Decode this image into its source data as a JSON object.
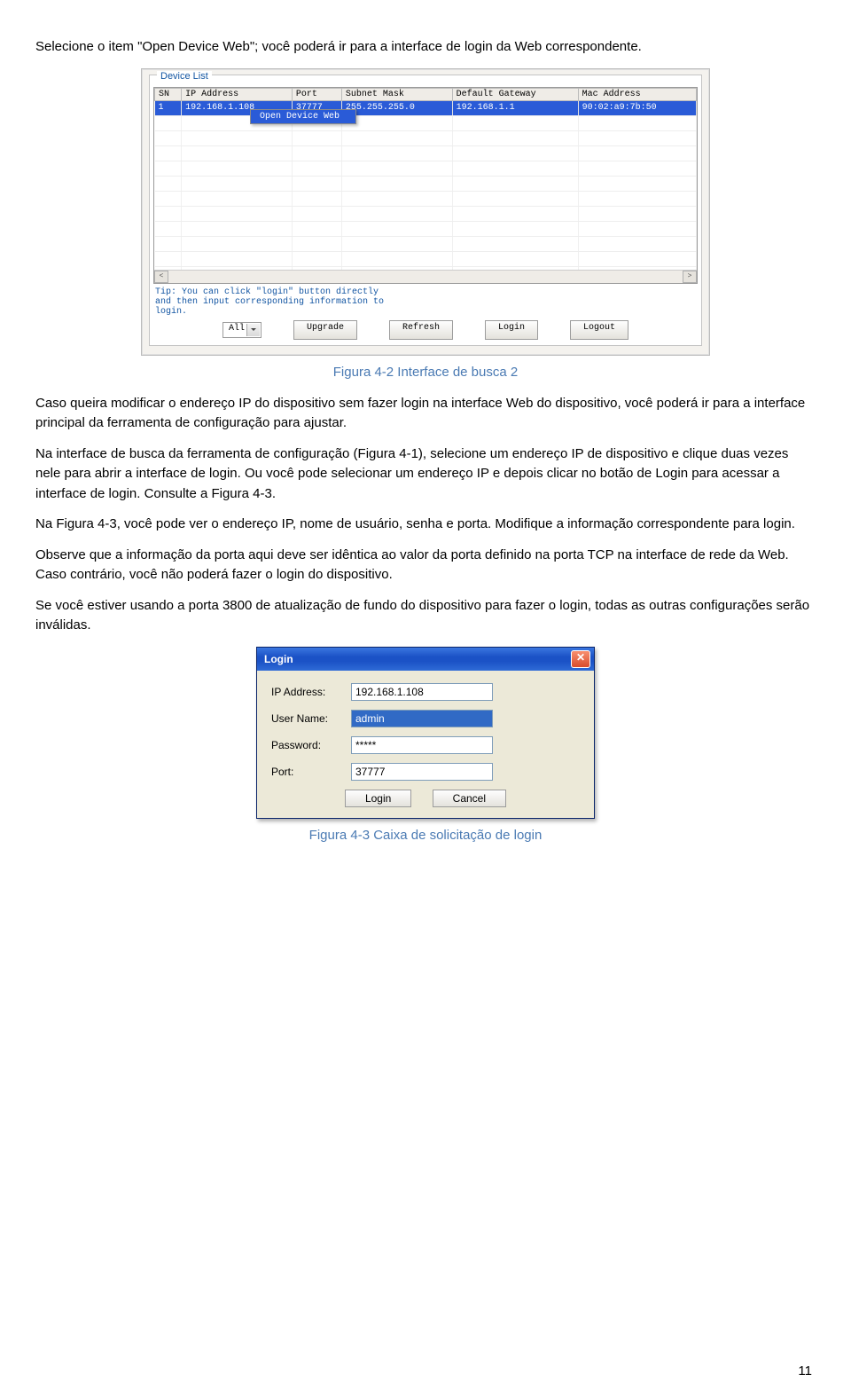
{
  "intro": "Selecione o item \"Open Device Web\"; você poderá ir para a interface de login da Web correspondente.",
  "deviceList": {
    "frameLabel": "Device List",
    "headers": [
      "SN",
      "IP Address",
      "Port",
      "Subnet Mask",
      "Default Gateway",
      "Mac Address"
    ],
    "row": {
      "sn": "1",
      "ip": "192.168.1.108",
      "port": "37777",
      "mask": "255.255.255.0",
      "gateway": "192.168.1.1",
      "mac": "90:02:a9:7b:50"
    },
    "contextMenu": "Open Device Web",
    "tip": "Tip: You can click \"login\" button directly and then input corresponding information to login.",
    "combo": "All",
    "buttons": {
      "upgrade": "Upgrade",
      "refresh": "Refresh",
      "login": "Login",
      "logout": "Logout"
    }
  },
  "caption1": "Figura 4-2 Interface de busca 2",
  "para1": "Caso queira modificar o endereço IP do dispositivo sem fazer login na interface Web do dispositivo, você poderá ir para a interface principal da ferramenta de configuração para ajustar.",
  "para2": "Na interface de busca da ferramenta de configuração (Figura 4-1), selecione um endereço IP de dispositivo e clique duas vezes nele para abrir a interface de login. Ou você pode selecionar um endereço IP e depois clicar no botão de Login para acessar a interface de login. Consulte a Figura 4-3.",
  "para3": "Na Figura 4-3, você pode ver o endereço IP, nome de usuário, senha e porta. Modifique a informação correspondente para login.",
  "para4": "Observe que a informação da porta aqui deve ser idêntica ao valor da porta definido na porta TCP na interface de rede da Web. Caso contrário, você não poderá fazer o login do dispositivo.",
  "para5": "Se você estiver usando a porta 3800 de atualização de fundo do dispositivo para fazer o login, todas as outras configurações serão inválidas.",
  "login": {
    "title": "Login",
    "ipLabel": "IP Address:",
    "ipValue": "192.168.1.108",
    "userLabel": "User Name:",
    "userValue": "admin",
    "pwdLabel": "Password:",
    "pwdValue": "*****",
    "portLabel": "Port:",
    "portValue": "37777",
    "btnLogin": "Login",
    "btnCancel": "Cancel"
  },
  "caption2": "Figura 4-3 Caixa de solicitação de login",
  "pageNumber": "11"
}
